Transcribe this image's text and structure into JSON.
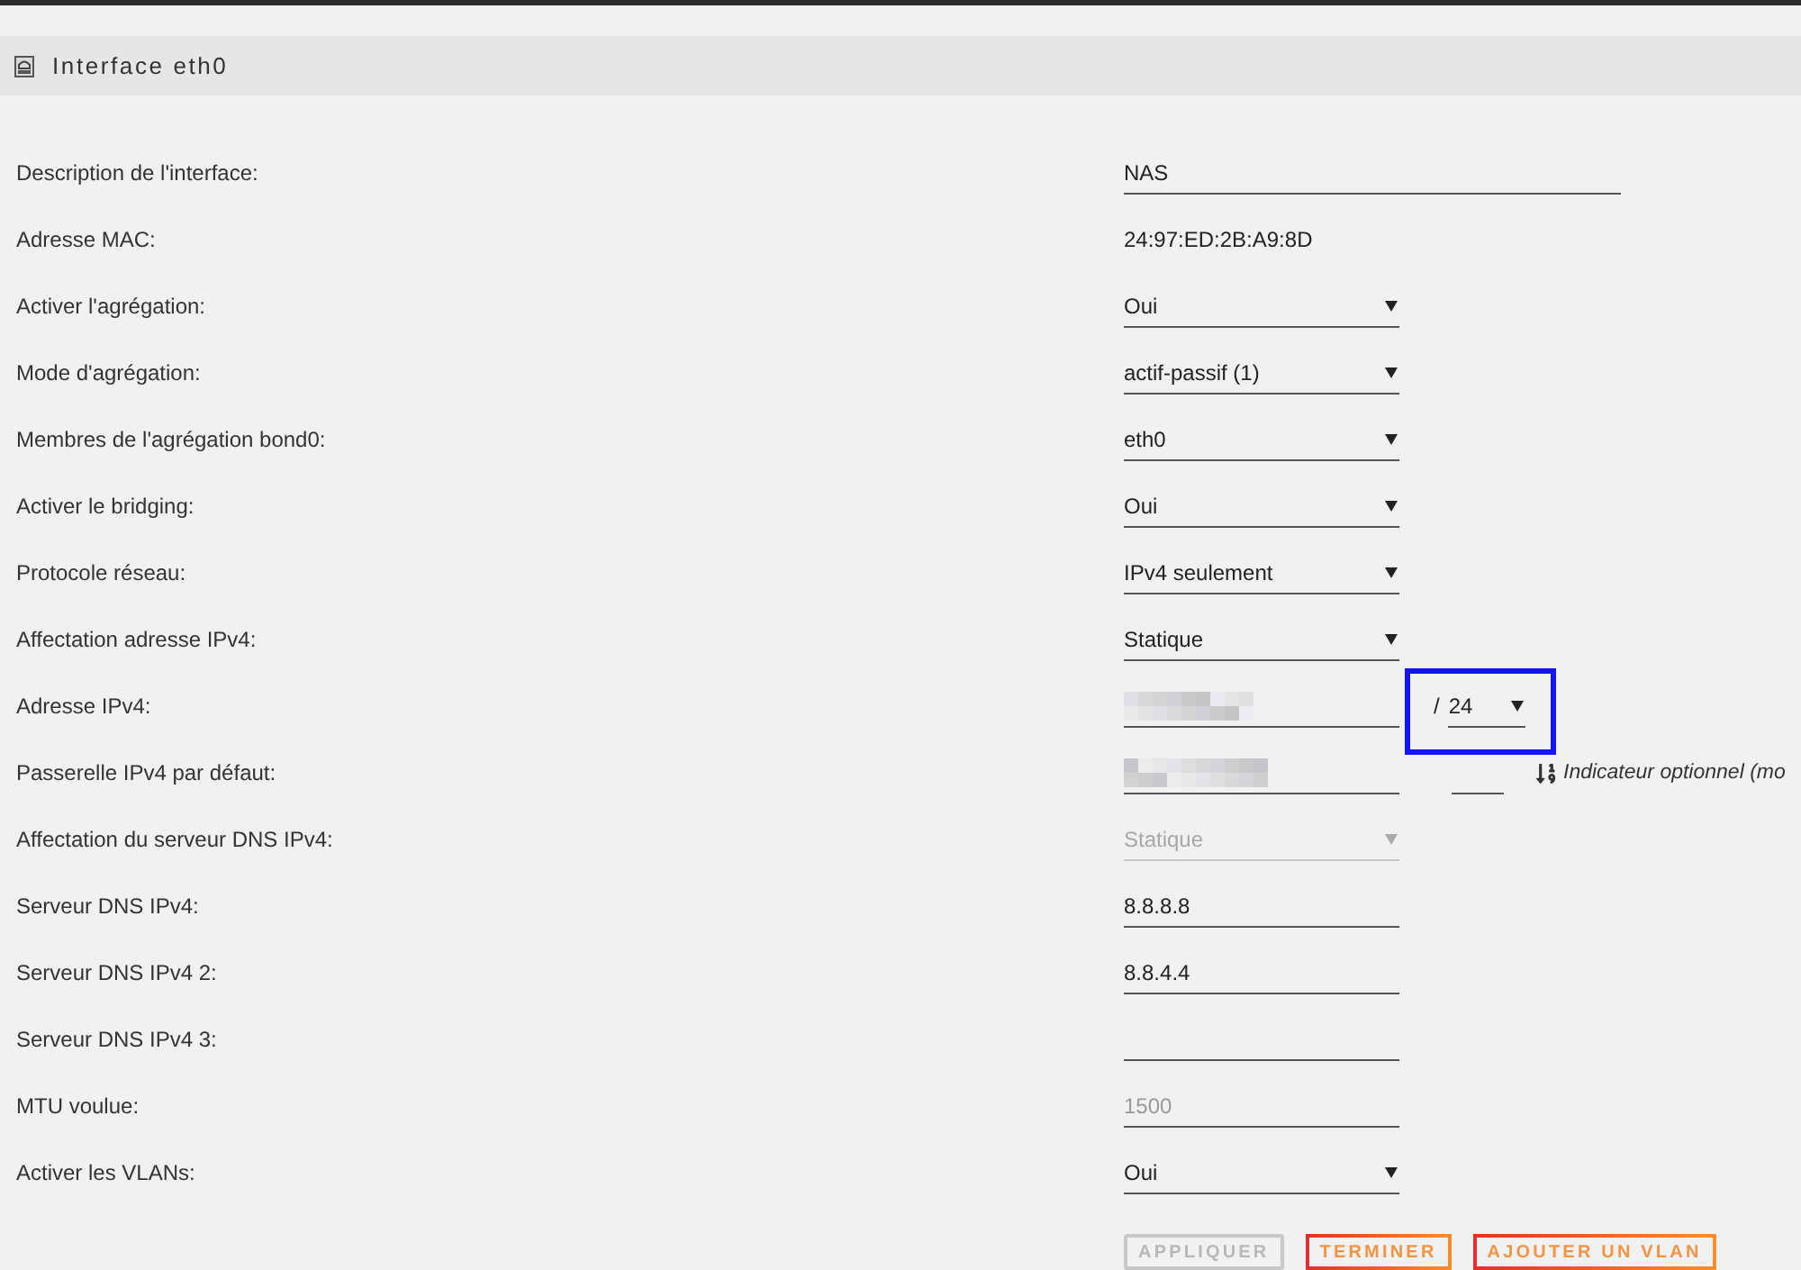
{
  "panel": {
    "title": "Interface eth0"
  },
  "fields": [
    {
      "label": "Description de l'interface:",
      "kind": "long_text",
      "value": "NAS",
      "disabled": false
    },
    {
      "label": "Adresse MAC:",
      "kind": "static",
      "value": "24:97:ED:2B:A9:8D",
      "disabled": false
    },
    {
      "label": "Activer l'agrégation:",
      "kind": "select",
      "value": "Oui",
      "disabled": false
    },
    {
      "label": "Mode d'agrégation:",
      "kind": "select",
      "value": "actif-passif (1)",
      "disabled": false
    },
    {
      "label": "Membres de l'agrégation bond0:",
      "kind": "select",
      "value": "eth0",
      "disabled": false
    },
    {
      "label": "Activer le bridging:",
      "kind": "select",
      "value": "Oui",
      "disabled": false
    },
    {
      "label": "Protocole réseau:",
      "kind": "select",
      "value": "IPv4 seulement",
      "disabled": false
    },
    {
      "label": "Affectation adresse IPv4:",
      "kind": "select",
      "value": "Statique",
      "disabled": false
    },
    {
      "label": "Adresse IPv4:",
      "kind": "redacted",
      "disabled": false,
      "netmask": {
        "prefix": "/",
        "value": "24",
        "highlighted": true
      }
    },
    {
      "label": "Passerelle IPv4 par défaut:",
      "kind": "redacted",
      "disabled": false,
      "metric": {
        "hint": "Indicateur optionnel (mo"
      }
    },
    {
      "label": "Affectation du serveur DNS IPv4:",
      "kind": "select",
      "value": "Statique",
      "disabled": true
    },
    {
      "label": "Serveur DNS IPv4:",
      "kind": "text",
      "value": "8.8.8.8",
      "disabled": false
    },
    {
      "label": "Serveur DNS IPv4 2:",
      "kind": "text",
      "value": "8.8.4.4",
      "disabled": false
    },
    {
      "label": "Serveur DNS IPv4 3:",
      "kind": "text",
      "disabled": false
    },
    {
      "label": "MTU voulue:",
      "kind": "text",
      "placeholder": "1500",
      "disabled": false
    },
    {
      "label": "Activer les VLANs:",
      "kind": "select",
      "value": "Oui",
      "disabled": false
    }
  ],
  "buttons": [
    {
      "label": "APPLIQUER",
      "disabled": true
    },
    {
      "label": "TERMINER",
      "disabled": false
    },
    {
      "label": "AJOUTER UN VLAN",
      "disabled": false
    }
  ]
}
